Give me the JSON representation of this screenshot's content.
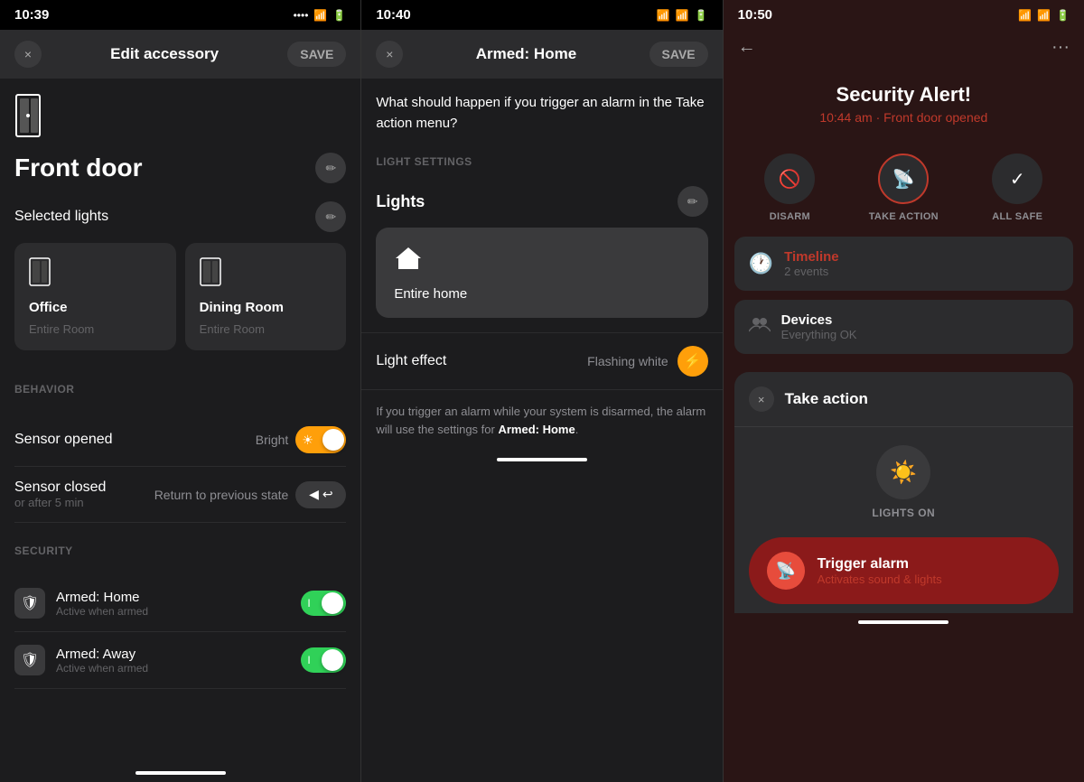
{
  "panel1": {
    "statusBar": {
      "time": "10:39",
      "icons": [
        "...",
        "wifi",
        "battery"
      ]
    },
    "header": {
      "closeLabel": "×",
      "title": "Edit accessory",
      "saveLabel": "SAVE"
    },
    "deviceIcon": "🔌",
    "deviceName": "Front door",
    "selectedLightsTitle": "Selected lights",
    "lights": [
      {
        "icon": "🚪",
        "name": "Office",
        "room": "Entire Room"
      },
      {
        "icon": "🚪",
        "name": "Dining Room",
        "room": "Entire Room"
      }
    ],
    "sections": {
      "behavior": {
        "label": "BEHAVIOR",
        "items": [
          {
            "title": "Sensor opened",
            "value": "Bright",
            "type": "sun-toggle"
          },
          {
            "title": "Sensor closed",
            "sub": "or after 5 min",
            "value": "Return to previous state",
            "type": "return-icon"
          }
        ]
      },
      "security": {
        "label": "SECURITY",
        "items": [
          {
            "icon": "🛡",
            "name": "Armed: Home",
            "sub": "Active when armed",
            "toggled": true
          },
          {
            "icon": "🛡",
            "name": "Armed: Away",
            "sub": "Active when armed",
            "toggled": true
          }
        ]
      }
    }
  },
  "panel2": {
    "statusBar": {
      "time": "10:40"
    },
    "header": {
      "title": "Armed: Home",
      "saveLabel": "SAVE"
    },
    "description": "What should happen if you trigger an alarm in the Take action menu?",
    "lightSettings": {
      "sectionLabel": "LIGHT SETTINGS",
      "lightsTitle": "Lights",
      "homeCard": {
        "icon": "🏠",
        "label": "Entire home"
      },
      "lightEffect": {
        "title": "Light effect",
        "value": "Flashing white",
        "icon": "⚡"
      }
    },
    "footerNote": "If you trigger an alarm while your system is disarmed, the alarm will use the settings for ",
    "footerBold": "Armed: Home",
    "footerEnd": "."
  },
  "panel3": {
    "statusBar": {
      "time": "10:50"
    },
    "header": {
      "backIcon": "←",
      "moreIcon": "···"
    },
    "alert": {
      "title": "Security Alert!",
      "subtitle": "10:44 am · Front door  opened"
    },
    "actions": [
      {
        "icon": "🚫",
        "label": "DISARM",
        "type": "normal"
      },
      {
        "icon": "📡",
        "label": "TAKE ACTION",
        "type": "radio-active"
      },
      {
        "icon": "✓",
        "label": "ALL SAFE",
        "type": "check"
      }
    ],
    "timeline": {
      "icon": "🕐",
      "title": "Timeline",
      "sub": "2 events"
    },
    "devices": {
      "icon": "👥",
      "title": "Devices",
      "sub": "Everything OK"
    },
    "takeAction": {
      "title": "Take action",
      "lightsOn": "LIGHTS ON",
      "triggerAlarm": {
        "title": "Trigger alarm",
        "sub": "Activates sound & lights"
      }
    }
  }
}
